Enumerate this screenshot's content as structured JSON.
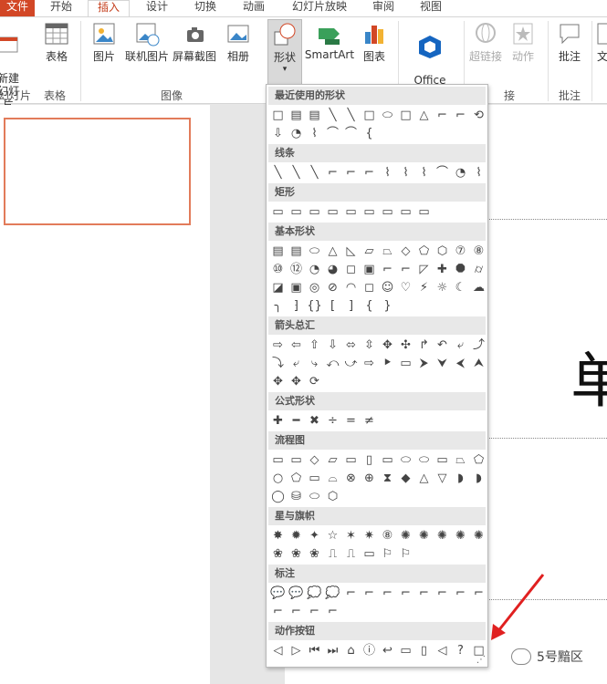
{
  "tabs": [
    "文件",
    "开始",
    "插入",
    "设计",
    "切换",
    "动画",
    "幻灯片放映",
    "审阅",
    "视图"
  ],
  "ribbon": {
    "new_slide": "新建\n幻灯片",
    "table": "表格",
    "picture": "图片",
    "online_picture": "联机图片",
    "screenshot": "屏幕截图",
    "album": "相册",
    "shapes": "形状",
    "smartart": "SmartArt",
    "chart": "图表",
    "office_apps": "Office\n应用程序",
    "hyperlink": "超链接",
    "action": "动作",
    "comment": "批注",
    "text": "文",
    "groups": {
      "slides": "幻灯片",
      "tables": "表格",
      "images": "图像",
      "links": "接",
      "comments": "批注"
    }
  },
  "canvas_char": "单",
  "panel": {
    "sections": [
      {
        "title": "最近使用的形状",
        "rows": [
          [
            "□",
            "▤",
            "▤",
            "╲",
            "╲",
            "□",
            "⬭",
            "□",
            "△",
            "⌐",
            "⌐",
            "⟲"
          ],
          [
            "⇩",
            "◔",
            "⌇",
            "⌒",
            "⌒",
            "{"
          ]
        ]
      },
      {
        "title": "线条",
        "rows": [
          [
            "╲",
            "╲",
            "╲",
            "⌐",
            "⌐",
            "⌐",
            "⌇",
            "⌇",
            "⌇",
            "⌒",
            "◔",
            "⌇"
          ]
        ]
      },
      {
        "title": "矩形",
        "rows": [
          [
            "▭",
            "▭",
            "▭",
            "▭",
            "▭",
            "▭",
            "▭",
            "▭",
            "▭"
          ]
        ]
      },
      {
        "title": "基本形状",
        "rows": [
          [
            "▤",
            "▤",
            "⬭",
            "△",
            "◺",
            "▱",
            "⏢",
            "◇",
            "⬠",
            "⬡",
            "⑦",
            "⑧"
          ],
          [
            "⑩",
            "⑫",
            "◔",
            "◕",
            "◻",
            "▣",
            "⌐",
            "⌐",
            "◸",
            "✚",
            "⯃",
            "⌭"
          ],
          [
            "◪",
            "▣",
            "◎",
            "⊘",
            "◠",
            "◻",
            "☺",
            "♡",
            "⚡",
            "☼",
            "☾",
            "☁"
          ],
          [
            "╮",
            "⁆",
            "{}",
            "[",
            "]",
            "{",
            "}"
          ]
        ]
      },
      {
        "title": "箭头总汇",
        "rows": [
          [
            "⇨",
            "⇦",
            "⇧",
            "⇩",
            "⬄",
            "⇳",
            "✥",
            "✣",
            "↱",
            "↶",
            "⤶",
            "⤴"
          ],
          [
            "⤵",
            "⤶",
            "⤷",
            "⤺",
            "⤻",
            "⇨",
            "⯈",
            "▭",
            "⮞",
            "⮟",
            "⮜",
            "⮝"
          ],
          [
            "✥",
            "✥",
            "⟳"
          ]
        ]
      },
      {
        "title": "公式形状",
        "rows": [
          [
            "✚",
            "━",
            "✖",
            "÷",
            "=",
            "≠"
          ]
        ]
      },
      {
        "title": "流程图",
        "rows": [
          [
            "▭",
            "▭",
            "◇",
            "▱",
            "▭",
            "▯",
            "▭",
            "⬭",
            "⬭",
            "▭",
            "⏢",
            "⬠"
          ],
          [
            "○",
            "⬠",
            "▭",
            "⌓",
            "⊗",
            "⊕",
            "⧗",
            "◆",
            "△",
            "▽",
            "◗",
            "◗"
          ],
          [
            "◯",
            "⛁",
            "⬭",
            "⬡"
          ]
        ]
      },
      {
        "title": "星与旗帜",
        "rows": [
          [
            "✸",
            "✹",
            "✦",
            "☆",
            "✶",
            "✷",
            "⑧",
            "✺",
            "✺",
            "✺",
            "✺",
            "✺"
          ],
          [
            "❀",
            "❀",
            "❀",
            "⎍",
            "⎍",
            "▭",
            "⚐",
            "⚐"
          ]
        ]
      },
      {
        "title": "标注",
        "rows": [
          [
            "💬",
            "💬",
            "💭",
            "💭",
            "⌐",
            "⌐",
            "⌐",
            "⌐",
            "⌐",
            "⌐",
            "⌐",
            "⌐"
          ],
          [
            "⌐",
            "⌐",
            "⌐",
            "⌐"
          ]
        ]
      },
      {
        "title": "动作按钮",
        "rows": [
          [
            "◁",
            "▷",
            "⏮",
            "⏭",
            "⌂",
            "ⓘ",
            "↩",
            "▭",
            "▯",
            "◁",
            "?",
            "□"
          ]
        ]
      }
    ]
  },
  "watermark": "5号黯区",
  "colors": {
    "accent": "#d24726",
    "arrow": "#e02020",
    "thumb_border": "#e27b5a"
  }
}
